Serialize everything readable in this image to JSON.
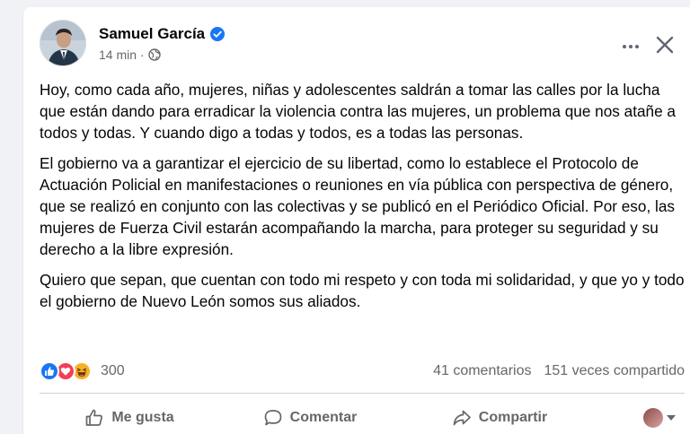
{
  "post": {
    "author": "Samuel García",
    "time": "14 min ·",
    "paragraphs": [
      "Hoy, como cada año, mujeres, niñas y adolescentes saldrán a tomar las calles por la lucha que están dando para erradicar la violencia contra las mujeres, un problema que nos atañe a todos y todas. Y cuando digo a todas y todos, es a todas las personas.",
      "El gobierno va a garantizar el ejercicio de su libertad, como lo establece el Protocolo de Actuación Policial en manifestaciones o reuniones en vía pública con perspectiva de género, que se realizó en conjunto con las colectivas y se publicó en el Periódico Oficial. Por eso, las mujeres de Fuerza Civil estarán acompañando la marcha, para proteger su seguridad y su derecho a la libre expresión.",
      "Quiero que sepan, que cuentan con todo mi respeto y con toda mi solidaridad, y que yo y todo el gobierno de Nuevo León somos sus aliados."
    ],
    "reaction_count": "300",
    "comments": "41 comentarios",
    "shares": "151 veces compartido"
  },
  "actions": {
    "like": "Me gusta",
    "comment": "Comentar",
    "share": "Compartir"
  },
  "icons": {
    "verified": "verified-badge-icon",
    "privacy": "globe-icon",
    "more": "more-options-icon",
    "close": "close-icon",
    "reactions": [
      "like-reaction-icon",
      "love-reaction-icon",
      "haha-reaction-icon"
    ]
  },
  "colors": {
    "brand_blue": "#1877f2",
    "love_red": "#f33e58",
    "haha_yellow": "#f7b125",
    "secondary_text": "#65676b"
  }
}
